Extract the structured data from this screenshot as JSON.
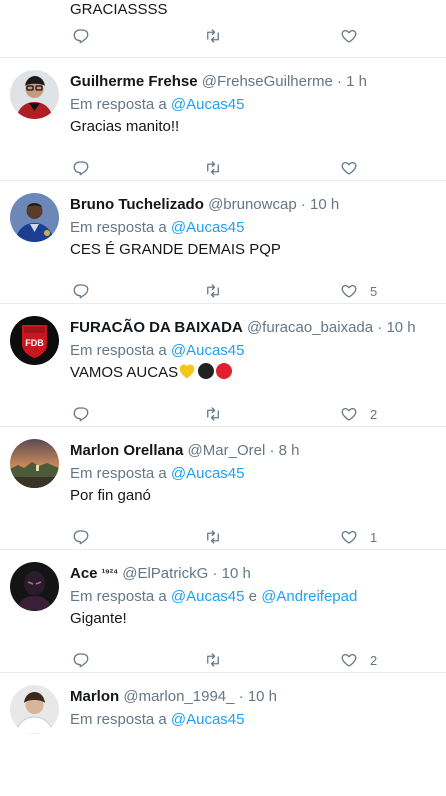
{
  "top_tweet": {
    "text": "GRACIASSSS",
    "like_count": ""
  },
  "tweets": [
    {
      "name": "Guilherme Frehse",
      "sup": "",
      "handle": "@FrehseGuilherme",
      "dot": "·",
      "time": "1 h",
      "reply_prefix": "Em resposta a ",
      "mention1": "@Aucas45",
      "joiner": "",
      "mention2": "",
      "text": "Gracias manito!!",
      "like_count": ""
    },
    {
      "name": "Bruno Tuchelizado",
      "sup": "",
      "handle": "@brunowcap",
      "dot": "·",
      "time": "10 h",
      "reply_prefix": "Em resposta a ",
      "mention1": "@Aucas45",
      "joiner": "",
      "mention2": "",
      "text": "CES É GRANDE DEMAIS PQP",
      "like_count": "5"
    },
    {
      "name": "FURACÃO DA BAIXADA",
      "sup": "",
      "handle": "@furacao_baixada",
      "dot": "·",
      "time": "10 h",
      "reply_prefix": "Em resposta a ",
      "mention1": "@Aucas45",
      "joiner": "",
      "mention2": "",
      "text": "VAMOS AUCAS",
      "like_count": "2"
    },
    {
      "name": "Marlon Orellana",
      "sup": "",
      "handle": "@Mar_Orel",
      "dot": "·",
      "time": "8 h",
      "reply_prefix": "Em resposta a ",
      "mention1": "@Aucas45",
      "joiner": "",
      "mention2": "",
      "text": "Por fin ganó",
      "like_count": "1"
    },
    {
      "name": "Ace",
      "sup": "¹⁹²⁴",
      "handle": "@ElPatrickG",
      "dot": "·",
      "time": "10 h",
      "reply_prefix": "Em resposta a ",
      "mention1": "@Aucas45",
      "joiner": " e ",
      "mention2": "@Andreifepad",
      "text": "Gigante!",
      "like_count": "2"
    },
    {
      "name": "Marlon",
      "sup": "",
      "handle": "@marlon_1994_",
      "dot": "·",
      "time": "10 h",
      "reply_prefix": "Em resposta a ",
      "mention1": "@Aucas45",
      "joiner": "",
      "mention2": "",
      "text": "",
      "like_count": ""
    }
  ],
  "avatars": {
    "t2_badge": "FDB"
  },
  "icons": {
    "reply": "reply-icon",
    "retweet": "retweet-icon",
    "like": "heart-icon"
  },
  "colors": {
    "link": "#1da1f2",
    "muted": "#657786",
    "divider": "#e6ecf0",
    "emoji_yellow": "#f5c518",
    "emoji_black": "#222222",
    "emoji_red": "#e0202e"
  }
}
